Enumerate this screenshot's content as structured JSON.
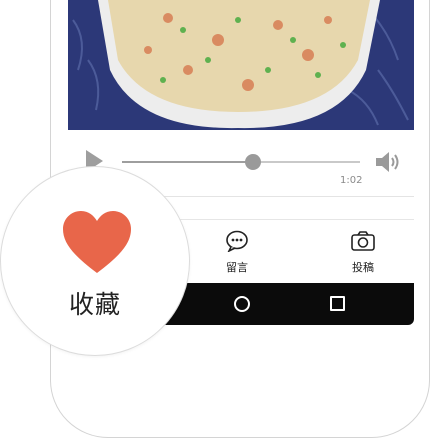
{
  "image": {
    "content": "fried-rice-bowl"
  },
  "player": {
    "time": "1:02",
    "progress": 0.55
  },
  "tabbar": {
    "tabs": [
      {
        "label": "留言",
        "icon": "comment-icon"
      },
      {
        "label": "投稿",
        "icon": "camera-icon"
      }
    ]
  },
  "favorite": {
    "label": "收藏",
    "icon": "heart-icon",
    "color": "#e8664a"
  },
  "android_nav": {
    "buttons": [
      "home-icon",
      "recents-icon"
    ]
  }
}
